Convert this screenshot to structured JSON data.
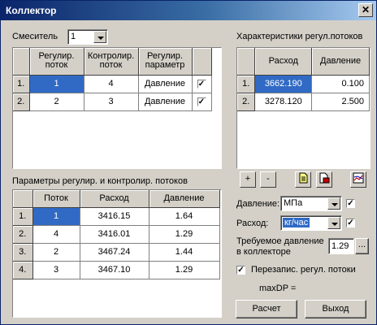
{
  "window": {
    "title": "Коллектор",
    "close": "✕"
  },
  "mixer": {
    "label": "Смеситель",
    "value": "1"
  },
  "top_grid": {
    "headers": [
      "Регулир. поток",
      "Контролир. поток",
      "Регулир. параметр"
    ],
    "rows": [
      {
        "n": "1.",
        "reg": "1",
        "ctl": "4",
        "param": "Давление",
        "checked": true
      },
      {
        "n": "2.",
        "reg": "2",
        "ctl": "3",
        "param": "Давление",
        "checked": true
      }
    ]
  },
  "char": {
    "label": "Характеристики регул.потоков",
    "headers": [
      "Расход",
      "Давление"
    ],
    "rows": [
      {
        "n": "1.",
        "flow": "3662.190",
        "pressure": "0.100"
      },
      {
        "n": "2.",
        "flow": "3278.120",
        "pressure": "2.500"
      }
    ]
  },
  "params": {
    "label": "Параметры регулир. и контролир. потоков",
    "headers": [
      "Поток",
      "Расход",
      "Давление"
    ],
    "rows": [
      {
        "n": "1.",
        "stream": "1",
        "flow": "3416.15",
        "pressure": "1.64"
      },
      {
        "n": "2.",
        "stream": "4",
        "flow": "3416.01",
        "pressure": "1.29"
      },
      {
        "n": "3.",
        "stream": "2",
        "flow": "3467.24",
        "pressure": "1.44"
      },
      {
        "n": "4.",
        "stream": "3",
        "flow": "3467.10",
        "pressure": "1.29"
      }
    ]
  },
  "buttons": {
    "plus": "+",
    "minus": "-",
    "calc": "Расчет",
    "exit": "Выход",
    "browse": "..."
  },
  "units": {
    "pressure_label": "Давление:",
    "pressure_value": "МПа",
    "flow_label": "Расход:",
    "flow_value": "кг/час"
  },
  "required": {
    "line1": "Требуемое давление",
    "line2": "в коллекторе",
    "value": "1.29"
  },
  "overwrite": {
    "label": "Перезапис. регул. потоки",
    "checked": true
  },
  "maxdp": "maxDP =",
  "colors": {
    "title_bar": "#0a246a",
    "selection": "#316ac5",
    "face": "#d4d0c8"
  }
}
